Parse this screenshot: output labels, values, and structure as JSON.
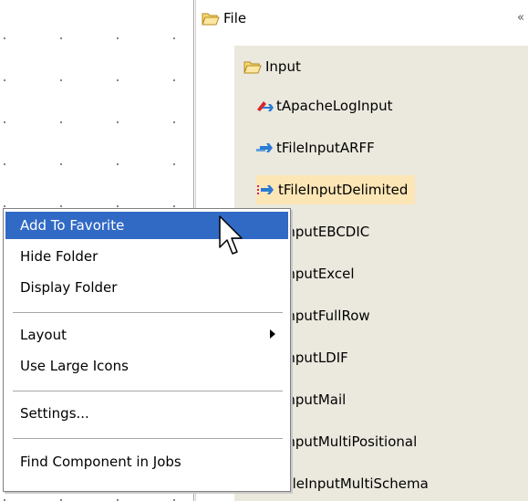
{
  "palette": {
    "folder": "File",
    "subfolder": "Input",
    "components": [
      "tApacheLogInput",
      "tFileInputARFF",
      "tFileInputDelimited",
      "tFileInputEBCDIC",
      "tFileInputExcel",
      "tFileInputFullRow",
      "tFileInputLDIF",
      "tFileInputMail",
      "tFileInputMultiPositional",
      "tFileInputMultiSchema"
    ],
    "selected_index": 2
  },
  "context_menu": {
    "items": [
      "Add To Favorite",
      "Hide Folder",
      "Display Folder",
      "Layout",
      "Use Large Icons",
      "Settings...",
      "Find Component in Jobs"
    ],
    "highlighted_index": 0
  },
  "colors": {
    "menu_highlight": "#316ac5",
    "panel_background": "#ebe8de",
    "selected_item": "#fde6b6"
  }
}
